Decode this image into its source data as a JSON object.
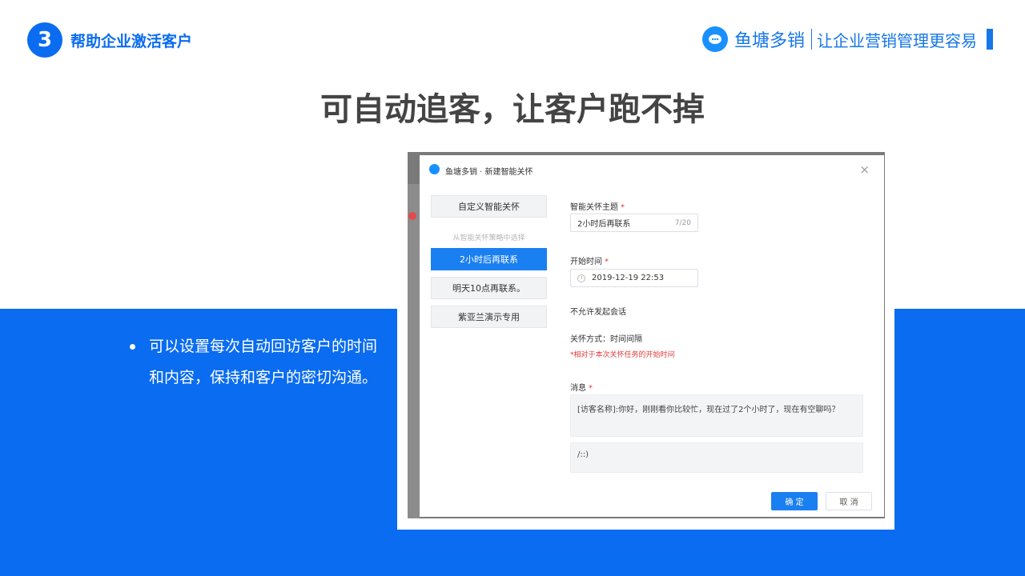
{
  "header": {
    "section_number": "3",
    "section_title": "帮助企业激活客户",
    "brand_name": "鱼塘多销",
    "brand_slogan": "让企业营销管理更容易"
  },
  "main_title": "可自动追客，让客户跑不掉",
  "bullet": {
    "text": "可以设置每次自动回访客户的时间和内容，保持和客户的密切沟通。"
  },
  "dialog": {
    "title": "鱼塘多销 · 新建智能关怀",
    "close_icon": "×",
    "sidebar": {
      "custom_option": "自定义智能关怀",
      "group_label": "从智能关怀策略中选择",
      "options": [
        "2小时后再联系",
        "明天10点再联系。",
        "紫亚兰演示专用"
      ],
      "active_index": 0
    },
    "form": {
      "topic_label": "智能关怀主题",
      "topic_value": "2小时后再联系",
      "topic_counter": "7/20",
      "start_label": "开始时间",
      "start_value": "2019-12-19 22:53",
      "no_session_text": "不允许发起会话",
      "method_text": "关怀方式：时间间隔",
      "method_note": "*相对于本次关怀任务的开始时间",
      "message_label": "消息",
      "message_1": "[访客名称]:你好，刚刚看你比较忙，现在过了2个小时了，现在有空聊吗？",
      "message_2": "/::)",
      "required_mark": "*"
    },
    "buttons": {
      "ok": "确 定",
      "cancel": "取 消"
    }
  },
  "colors": {
    "accent": "#0a6cf0",
    "title_gray": "#444444",
    "primary_button": "#1a7ff0",
    "required_red": "#e23a3a"
  }
}
